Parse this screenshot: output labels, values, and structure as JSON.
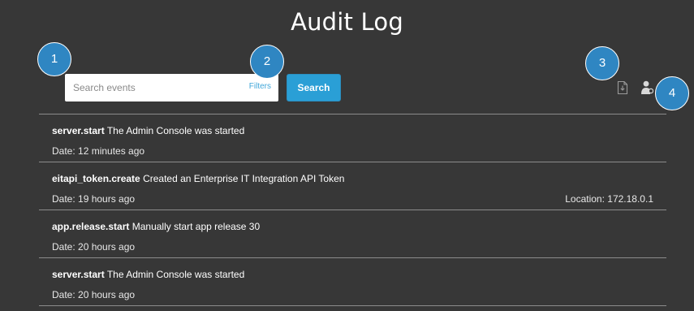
{
  "page": {
    "title": "Audit Log"
  },
  "search": {
    "placeholder": "Search events",
    "value": "",
    "filters_label": "Filters",
    "button_label": "Search"
  },
  "toolbar": {
    "export_icon": "file-download-icon",
    "user_icon": "user-filter-icon"
  },
  "markers": [
    "1",
    "2",
    "3",
    "4"
  ],
  "events": [
    {
      "name": "server.start",
      "description": "The Admin Console was started",
      "date": "Date: 12 minutes ago",
      "location": ""
    },
    {
      "name": "eitapi_token.create",
      "description": "Created an Enterprise IT Integration API Token",
      "date": "Date: 19 hours ago",
      "location": "Location: 172.18.0.1"
    },
    {
      "name": "app.release.start",
      "description": "Manually start app release 30",
      "date": "Date: 20 hours ago",
      "location": ""
    },
    {
      "name": "server.start",
      "description": "The Admin Console was started",
      "date": "Date: 20 hours ago",
      "location": ""
    }
  ],
  "colors": {
    "background": "#373737",
    "accent": "#2a9fd6",
    "marker": "#2f86c2",
    "divider": "#8c8c8c"
  }
}
